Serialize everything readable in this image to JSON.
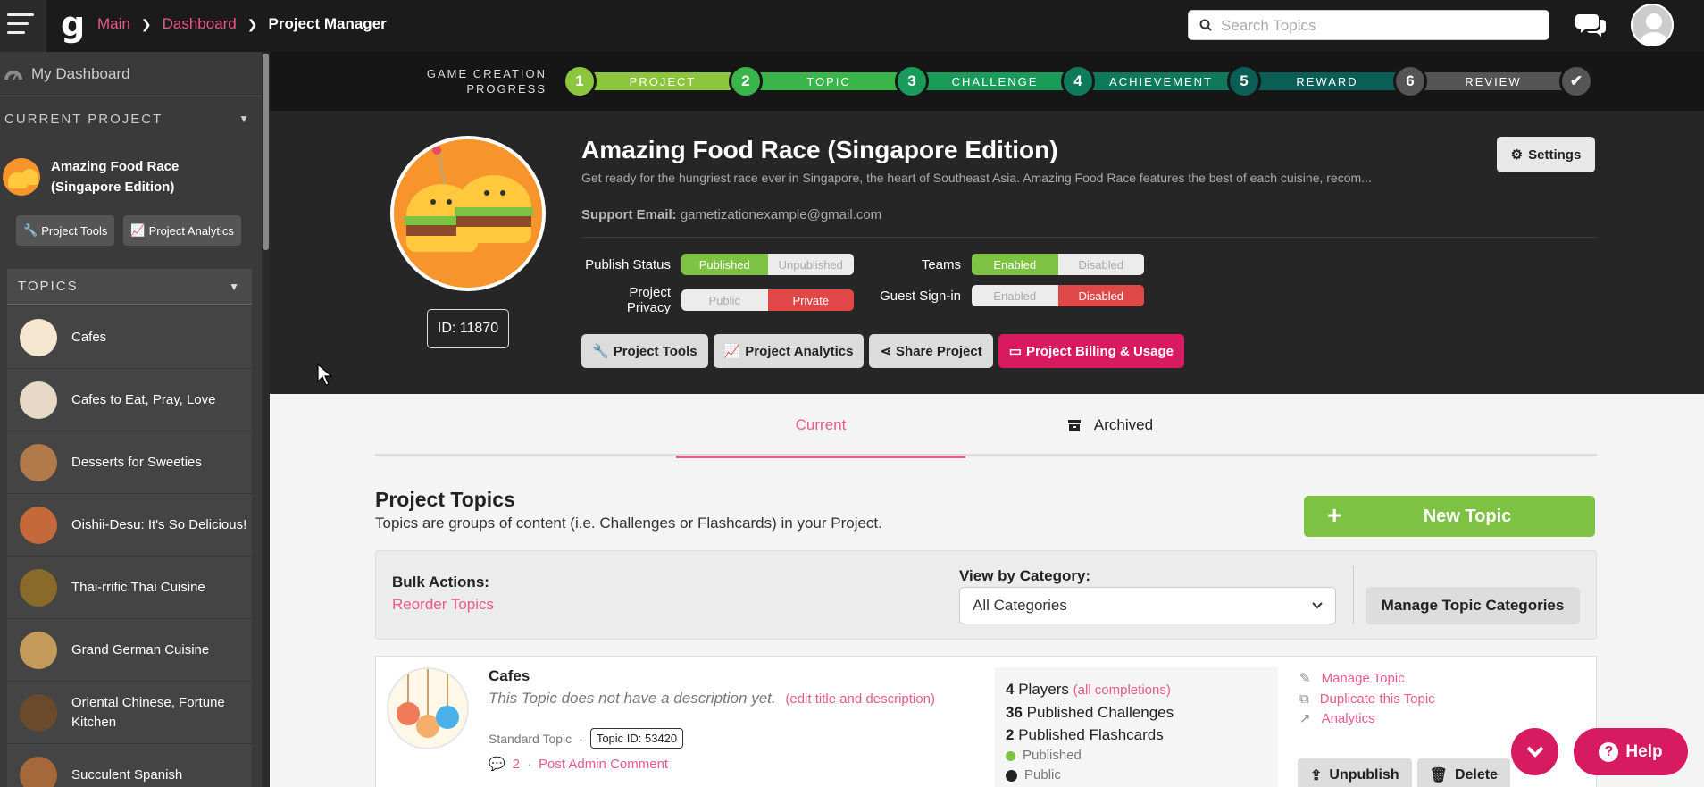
{
  "topbar": {
    "breadcrumbs": [
      "Main",
      "Dashboard",
      "Project Manager"
    ],
    "search_placeholder": "Search Topics"
  },
  "sidebar": {
    "my_dashboard": "My Dashboard",
    "current_project_label": "CURRENT PROJECT",
    "project_name": "Amazing Food Race (Singapore Edition)",
    "project_tools": "Project Tools",
    "project_analytics": "Project Analytics",
    "topics_label": "TOPICS",
    "topics": [
      {
        "label": "Cafes"
      },
      {
        "label": "Cafes to Eat, Pray, Love"
      },
      {
        "label": "Desserts for Sweeties"
      },
      {
        "label": "Oishii-Desu: It's So Delicious!"
      },
      {
        "label": "Thai-rrific Thai Cuisine"
      },
      {
        "label": "Grand German Cuisine"
      },
      {
        "label": "Oriental Chinese, Fortune Kitchen"
      },
      {
        "label": "Succulent Spanish"
      }
    ]
  },
  "progress": {
    "label": "GAME CREATION PROGRESS",
    "steps": [
      {
        "num": "1",
        "label": "PROJECT",
        "color": "#8cc63f"
      },
      {
        "num": "2",
        "label": "TOPIC",
        "color": "#39b54a"
      },
      {
        "num": "3",
        "label": "CHALLENGE",
        "color": "#1a9b5a"
      },
      {
        "num": "4",
        "label": "ACHIEVEMENT",
        "color": "#0f7a5a"
      },
      {
        "num": "5",
        "label": "REWARD",
        "color": "#0b5e55"
      },
      {
        "num": "6",
        "label": "REVIEW",
        "color": "#555555"
      }
    ]
  },
  "project": {
    "title": "Amazing Food Race (Singapore Edition)",
    "description": "Get ready for the hungriest race ever in Singapore, the heart of Southeast Asia. Amazing Food Race features the best of each cuisine, recom...",
    "support_label": "Support Email:",
    "support_email": "gametizationexample@gmail.com",
    "id_label": "ID: 11870",
    "settings": "Settings",
    "publish_status_label": "Publish Status",
    "publish_on": "Published",
    "publish_off": "Unpublished",
    "privacy_label": "Project Privacy",
    "privacy_public": "Public",
    "privacy_private": "Private",
    "teams_label": "Teams",
    "teams_enabled": "Enabled",
    "teams_disabled": "Disabled",
    "guest_label": "Guest Sign-in",
    "guest_enabled": "Enabled",
    "guest_disabled": "Disabled",
    "btn_tools": "Project Tools",
    "btn_analytics": "Project Analytics",
    "btn_share": "Share Project",
    "btn_billing": "Project Billing & Usage"
  },
  "tabs": {
    "current": "Current",
    "archived": "Archived"
  },
  "topics_section": {
    "title": "Project Topics",
    "subtitle": "Topics are groups of content (i.e. Challenges or Flashcards) in your Project.",
    "new_topic": "New Topic",
    "bulk_actions": "Bulk Actions:",
    "reorder": "Reorder Topics",
    "view_by_category": "View by Category:",
    "category_selected": "All Categories",
    "manage_categories": "Manage Topic Categories"
  },
  "topic_card": {
    "title": "Cafes",
    "description": "This Topic does not have a description yet.",
    "edit_link": "(edit title and description)",
    "type": "Standard Topic",
    "topic_id": "Topic ID: 53420",
    "comment_count": "2",
    "post_comment": "Post Admin Comment",
    "players_num": "4",
    "players_label": "Players",
    "all_completions": "(all completions)",
    "challenges_num": "36",
    "challenges_label": "Published Challenges",
    "flashcards_num": "2",
    "flashcards_label": "Published Flashcards",
    "status": "Published",
    "visibility": "Public",
    "manage": "Manage Topic",
    "duplicate": "Duplicate this Topic",
    "analytics": "Analytics",
    "unpublish": "Unpublish",
    "delete": "Delete"
  },
  "help": {
    "label": "Help"
  }
}
